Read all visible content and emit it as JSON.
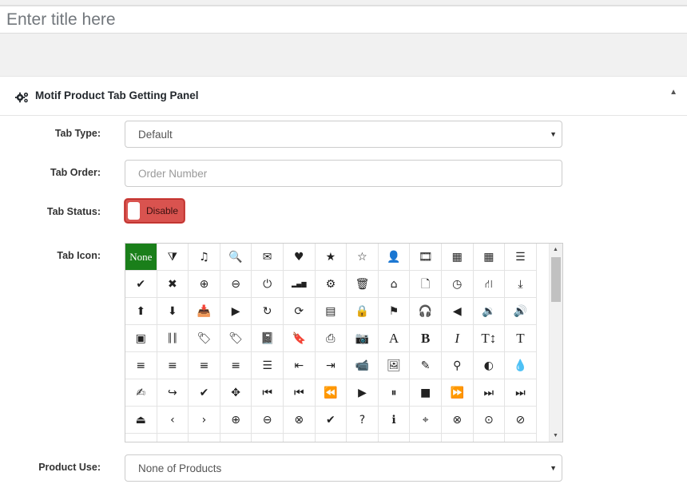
{
  "title_input": {
    "placeholder": "Enter title here",
    "value": ""
  },
  "panel": {
    "title": "Motif Product Tab Getting Panel",
    "icon": "gears-icon",
    "collapse_icon": "triangle-up-icon"
  },
  "form": {
    "tab_type": {
      "label": "Tab Type:",
      "value": "Default"
    },
    "tab_order": {
      "label": "Tab Order:",
      "placeholder": "Order Number",
      "value": ""
    },
    "tab_status": {
      "label": "Tab Status:",
      "toggle_label": "Disable",
      "state": "off",
      "color": "#d9534f"
    },
    "tab_icon": {
      "label": "Tab Icon:",
      "selected": "None",
      "selected_color": "#1a7f1a",
      "icons": [
        [
          "None",
          "filter-icon",
          "music-icon",
          "search-icon",
          "envelope-icon",
          "heart-icon",
          "star-icon",
          "star-empty-icon",
          "user-icon",
          "film-icon",
          "th-large-icon",
          "th-icon",
          "th-list-icon"
        ],
        [
          "ok-icon",
          "remove-icon",
          "zoom-in-icon",
          "zoom-out-icon",
          "off-icon",
          "signal-icon",
          "cog-icon",
          "trash-icon",
          "home-icon",
          "file-icon",
          "time-icon",
          "road-icon",
          "download-alt-icon"
        ],
        [
          "upload-icon",
          "download-icon",
          "inbox-icon",
          "play-circle-icon",
          "repeat-icon",
          "refresh-icon",
          "list-alt-icon",
          "lock-icon",
          "flag-icon",
          "headphones-icon",
          "volume-off-icon",
          "volume-down-icon",
          "volume-up-icon"
        ],
        [
          "qrcode-icon",
          "barcode-icon",
          "tag-icon",
          "tags-icon",
          "book-icon",
          "bookmark-icon",
          "print-icon",
          "camera-icon",
          "font-icon",
          "bold-icon",
          "italic-icon",
          "text-height-icon",
          "text-width-icon"
        ],
        [
          "align-left-icon",
          "align-center-icon",
          "align-right-icon",
          "align-justify-icon",
          "list-icon",
          "indent-left-icon",
          "indent-right-icon",
          "facetime-video-icon",
          "picture-icon",
          "pencil-icon",
          "map-marker-icon",
          "adjust-icon",
          "tint-icon"
        ],
        [
          "edit-icon",
          "share-icon",
          "check-icon",
          "move-icon",
          "step-backward-icon",
          "fast-backward-icon",
          "backward-icon",
          "play-icon",
          "pause-icon",
          "stop-icon",
          "forward-icon",
          "fast-forward-icon",
          "step-forward-icon"
        ],
        [
          "eject-icon",
          "chevron-left-icon",
          "chevron-right-icon",
          "plus-sign-icon",
          "minus-sign-icon",
          "remove-sign-icon",
          "ok-sign-icon",
          "question-sign-icon",
          "info-sign-icon",
          "screenshot-icon",
          "remove-circle-icon",
          "ok-circle-icon",
          "ban-circle-icon"
        ]
      ]
    },
    "product_use": {
      "label": "Product Use:",
      "value": "None of Products"
    }
  }
}
